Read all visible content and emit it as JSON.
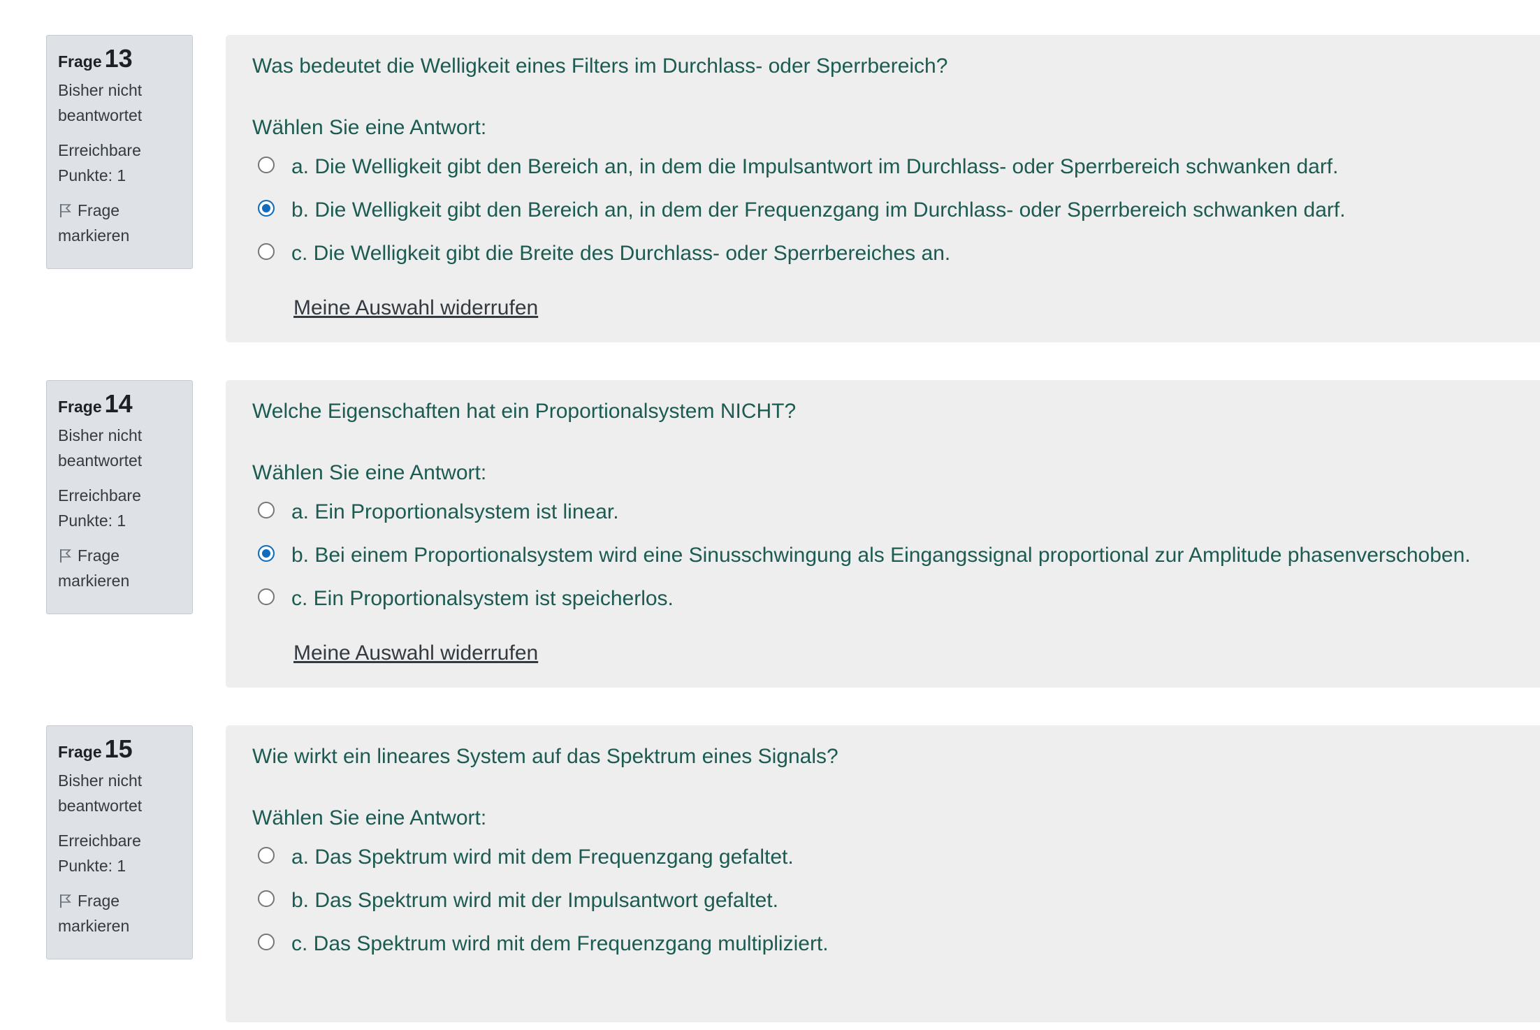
{
  "questions": [
    {
      "label": "Frage",
      "number": "13",
      "state": "Bisher nicht beantwortet",
      "grade": "Erreichbare Punkte: 1",
      "flag": "Frage markieren",
      "text": "Was bedeutet die Welligkeit eines Filters im Durchlass- oder Sperrbereich?",
      "prompt": "Wählen Sie eine Antwort:",
      "answers": [
        {
          "label": "a. Die Welligkeit gibt den Bereich an, in dem die Impulsantwort im Durchlass- oder Sperrbereich schwanken darf.",
          "selected": false
        },
        {
          "label": "b. Die Welligkeit gibt den Bereich an, in dem der Frequenzgang im Durchlass- oder Sperrbereich schwanken darf.",
          "selected": true
        },
        {
          "label": "c. Die Welligkeit gibt die Breite des Durchlass- oder Sperrbereiches an.",
          "selected": false
        }
      ],
      "clear_label": "Meine Auswahl widerrufen"
    },
    {
      "label": "Frage",
      "number": "14",
      "state": "Bisher nicht beantwortet",
      "grade": "Erreichbare Punkte: 1",
      "flag": "Frage markieren",
      "text": "Welche Eigenschaften hat ein Proportionalsystem NICHT?",
      "prompt": "Wählen Sie eine Antwort:",
      "answers": [
        {
          "label": "a. Ein Proportionalsystem ist linear.",
          "selected": false
        },
        {
          "label": "b. Bei einem Proportionalsystem wird eine Sinusschwingung als Eingangssignal proportional zur Amplitude phasenverschoben.",
          "selected": true
        },
        {
          "label": "c. Ein Proportionalsystem ist speicherlos.",
          "selected": false
        }
      ],
      "clear_label": "Meine Auswahl widerrufen"
    },
    {
      "label": "Frage",
      "number": "15",
      "state": "Bisher nicht beantwortet",
      "grade": "Erreichbare Punkte: 1",
      "flag": "Frage markieren",
      "text": "Wie wirkt ein lineares System auf das Spektrum eines Signals?",
      "prompt": "Wählen Sie eine Antwort:",
      "answers": [
        {
          "label": "a. Das Spektrum wird mit dem Frequenzgang gefaltet.",
          "selected": false
        },
        {
          "label": "b. Das Spektrum wird mit der Impulsantwort gefaltet.",
          "selected": false
        },
        {
          "label": "c. Das Spektrum wird mit dem Frequenzgang multipliziert.",
          "selected": false
        }
      ],
      "clear_label": ""
    }
  ]
}
